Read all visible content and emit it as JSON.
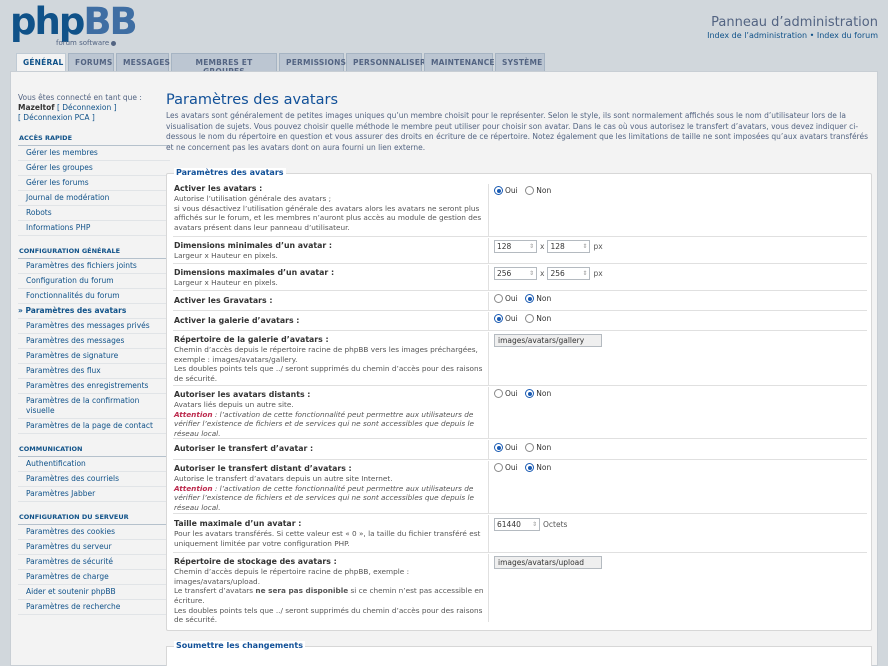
{
  "header": {
    "logo_php": "php",
    "logo_bb": "BB",
    "logo_sub": "forum software",
    "panel_title": "Panneau d’administration",
    "link_admin_index": "Index de l’administration",
    "link_sep": " • ",
    "link_forum_index": "Index du forum"
  },
  "tabs": [
    "GÉNÉRAL",
    "FORUMS",
    "MESSAGES",
    "MEMBRES ET GROUPES",
    "PERMISSIONS",
    "PERSONNALISER",
    "MAINTENANCE",
    "SYSTÈME"
  ],
  "sidebar": {
    "logged_as": "Vous êtes connecté en tant que :",
    "username": "Mazeltof",
    "logout": "[ Déconnexion ]",
    "logout_acp": "[ Déconnexion PCA ]",
    "quick_access": {
      "heading": "ACCÈS RAPIDE",
      "items": [
        "Gérer les membres",
        "Gérer les groupes",
        "Gérer les forums",
        "Journal de modération",
        "Robots",
        "Informations PHP"
      ]
    },
    "general_config": {
      "heading": "CONFIGURATION GÉNÉRALE",
      "items": [
        "Paramètres des fichiers joints",
        "Configuration du forum",
        "Fonctionnalités du forum",
        "Paramètres des avatars",
        "Paramètres des messages privés",
        "Paramètres des messages",
        "Paramètres de signature",
        "Paramètres des flux",
        "Paramètres des enregistrements",
        "Paramètres de la confirmation visuelle",
        "Paramètres de la page de contact"
      ]
    },
    "communication": {
      "heading": "COMMUNICATION",
      "items": [
        "Authentification",
        "Paramètres des courriels",
        "Paramètres Jabber"
      ]
    },
    "server_config": {
      "heading": "CONFIGURATION DU SERVEUR",
      "items": [
        "Paramètres des cookies",
        "Paramètres du serveur",
        "Paramètres de sécurité",
        "Paramètres de charge",
        "Aider et soutenir phpBB",
        "Paramètres de recherche"
      ]
    }
  },
  "main": {
    "title": "Paramètres des avatars",
    "intro": "Les avatars sont généralement de petites images uniques qu’un membre choisit pour le représenter. Selon le style, ils sont normalement affichés sous le nom d’utilisateur lors de la visualisation de sujets. Vous pouvez choisir quelle méthode le membre peut utiliser pour choisir son avatar. Dans le cas où vous autorisez le transfert d’avatars, vous devez indiquer ci-dessous le nom du répertoire en question et vous assurer des droits en écriture de ce répertoire. Notez également que les limitations de taille ne sont imposées qu’aux avatars transférés et ne concernent pas les avatars dont on aura fourni un lien externe.",
    "fieldset_legend": "Paramètres des avatars",
    "submit_legend": "Soumettre les changements",
    "yes": "Oui",
    "no": "Non",
    "times": "x",
    "px": "px",
    "octets": "Octets",
    "attention": "Attention",
    "settings": {
      "enable_avatars": {
        "label": "Activer les avatars :",
        "explain": "Autorise l’utilisation générale des avatars ;\nsi vous désactivez l’utilisation générale des avatars alors les avatars ne seront plus affichés sur le forum, et les membres n’auront plus accès au module de gestion des avatars présent dans leur panneau d’utilisateur."
      },
      "min_dims": {
        "label": "Dimensions minimales d’un avatar :",
        "explain": "Largeur x Hauteur en pixels.",
        "width": "128",
        "height": "128"
      },
      "max_dims": {
        "label": "Dimensions maximales d’un avatar :",
        "explain": "Largeur x Hauteur en pixels.",
        "width": "256",
        "height": "256"
      },
      "gravatar": {
        "label": "Activer les Gravatars :"
      },
      "gallery": {
        "label": "Activer la galerie d’avatars :"
      },
      "gallery_path": {
        "label": "Répertoire de la galerie d’avatars :",
        "explain": "Chemin d’accès depuis le répertoire racine de phpBB vers les images préchargées, exemple : images/avatars/gallery.\nLes doubles points tels que ../ seront supprimés du chemin d’accès pour des raisons de sécurité.",
        "value": "images/avatars/gallery"
      },
      "remote": {
        "label": "Autoriser les avatars distants :",
        "explain": "Avatars liés depuis un autre site.",
        "warning": " : l’activation de cette fonctionnalité peut permettre aux utilisateurs de vérifier l’existence de fichiers et de services qui ne sont accessibles que depuis le réseau local."
      },
      "upload": {
        "label": "Autoriser le transfert d’avatar :"
      },
      "remote_upload": {
        "label": "Autoriser le transfert distant d’avatars :",
        "explain": "Autorise le transfert d’avatars depuis un autre site Internet.",
        "warning": " : l’activation de cette fonctionnalité peut permettre aux utilisateurs de vérifier l’existence de fichiers et de services qui ne sont accessibles que depuis le réseau local."
      },
      "max_size": {
        "label": "Taille maximale d’un avatar :",
        "explain": "Pour les avatars transférés. Si cette valeur est « 0 », la taille du fichier transféré est uniquement limitée par votre configuration PHP.",
        "value": "61440"
      },
      "storage_path": {
        "label": "Répertoire de stockage des avatars :",
        "explain1": "Chemin d’accès depuis le répertoire racine de phpBB, exemple : images/avatars/upload.",
        "explain2a": "Le transfert d’avatars ",
        "explain2b": "ne sera pas disponible",
        "explain2c": " si ce chemin n’est pas accessible en écriture.",
        "explain3": "Les doubles points tels que ../ seront supprimés du chemin d’accès pour des raisons de sécurité.",
        "value": "images/avatars/upload"
      }
    }
  }
}
